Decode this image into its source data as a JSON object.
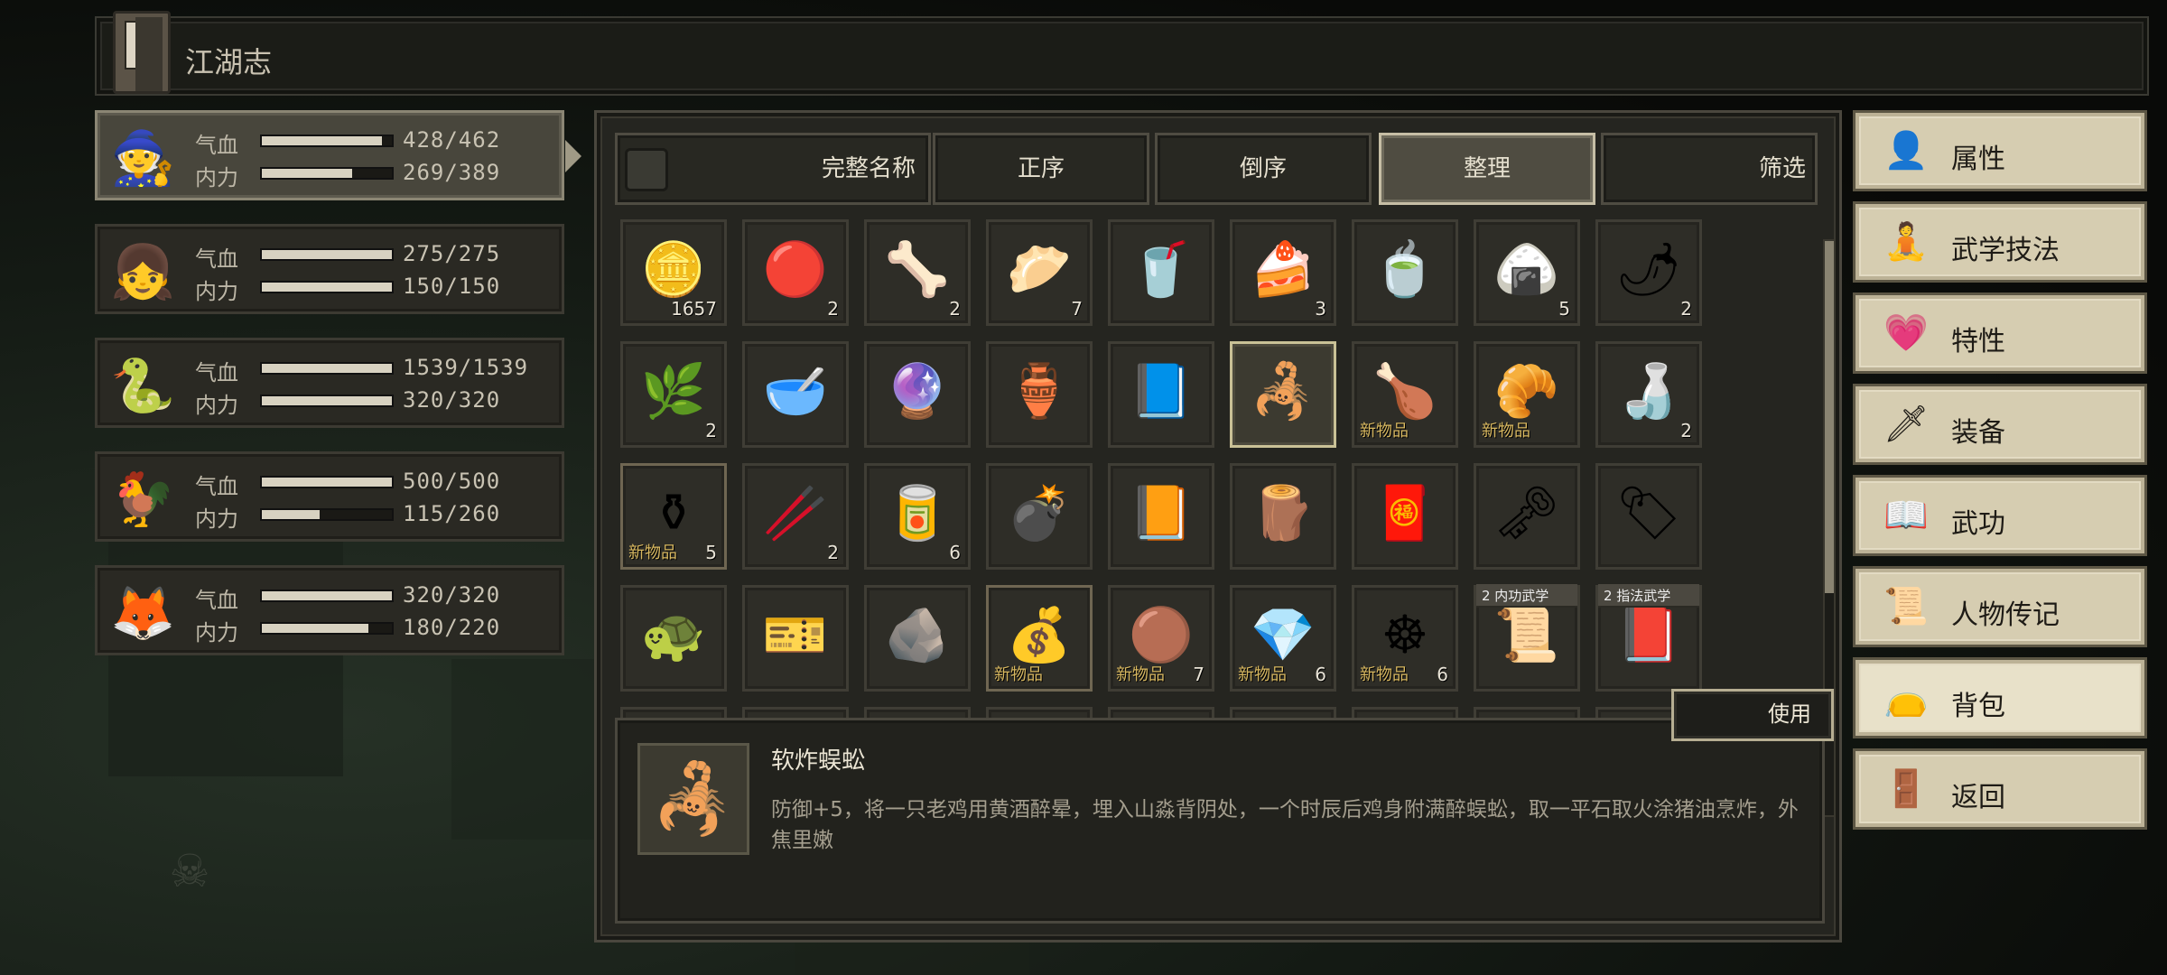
{
  "title": "江湖志",
  "party": [
    {
      "id": "hero",
      "portrait_icon": "swordsman-icon",
      "glyph": "🧙",
      "hp_label": "气血",
      "hp": "428/462",
      "hp_frac": 0.926,
      "mp_label": "内力",
      "mp": "269/389",
      "mp_frac": 0.692
    },
    {
      "id": "girl",
      "portrait_icon": "fox-girl-icon",
      "glyph": "👧",
      "hp_label": "气血",
      "hp": "275/275",
      "hp_frac": 1.0,
      "mp_label": "内力",
      "mp": "150/150",
      "mp_frac": 1.0
    },
    {
      "id": "snake",
      "portrait_icon": "snake-icon",
      "glyph": "🐍",
      "hp_label": "气血",
      "hp": "1539/1539",
      "hp_frac": 1.0,
      "mp_label": "内力",
      "mp": "320/320",
      "mp_frac": 1.0
    },
    {
      "id": "chicken",
      "portrait_icon": "chicken-icon",
      "glyph": "🐓",
      "hp_label": "气血",
      "hp": "500/500",
      "hp_frac": 1.0,
      "mp_label": "内力",
      "mp": "115/260",
      "mp_frac": 0.442
    },
    {
      "id": "fox",
      "portrait_icon": "fox-icon",
      "glyph": "🦊",
      "hp_label": "气血",
      "hp": "320/320",
      "hp_frac": 1.0,
      "mp_label": "内力",
      "mp": "180/220",
      "mp_frac": 0.818
    }
  ],
  "sort": {
    "fullname": "完整名称",
    "asc": "正序",
    "desc": "倒序",
    "arrange": "整理",
    "filter": "筛选",
    "active": "arrange"
  },
  "items": [
    {
      "icon": "copper-coins-icon",
      "glyph": "🪙",
      "count": "1657",
      "new": "",
      "tag": ""
    },
    {
      "icon": "red-coins-icon",
      "glyph": "🔴",
      "count": "2",
      "new": "",
      "tag": ""
    },
    {
      "icon": "bone-icon",
      "glyph": "🦴",
      "count": "2",
      "new": "",
      "tag": ""
    },
    {
      "icon": "steamed-bun-icon",
      "glyph": "🥟",
      "count": "7",
      "new": "",
      "tag": ""
    },
    {
      "icon": "wooden-cup-icon",
      "glyph": "🥤",
      "count": "",
      "new": "",
      "tag": ""
    },
    {
      "icon": "cake-icon",
      "glyph": "🍰",
      "count": "3",
      "new": "",
      "tag": ""
    },
    {
      "icon": "dark-cup-icon",
      "glyph": "🍵",
      "count": "",
      "new": "",
      "tag": ""
    },
    {
      "icon": "white-bun-icon",
      "glyph": "🍙",
      "count": "5",
      "new": "",
      "tag": ""
    },
    {
      "icon": "red-herb-icon",
      "glyph": "🌶",
      "count": "2",
      "new": "",
      "tag": ""
    },
    {
      "icon": "blue-herb-icon",
      "glyph": "🌿",
      "count": "2",
      "new": "",
      "tag": ""
    },
    {
      "icon": "blood-bowl-icon",
      "glyph": "🥣",
      "count": "",
      "new": "",
      "tag": ""
    },
    {
      "icon": "blue-orb-icon",
      "glyph": "🔮",
      "count": "",
      "new": "",
      "tag": ""
    },
    {
      "icon": "gourd-icon",
      "glyph": "🏺",
      "count": "",
      "new": "",
      "tag": ""
    },
    {
      "icon": "mystery-book-icon",
      "glyph": "📘",
      "count": "",
      "new": "",
      "tag": ""
    },
    {
      "icon": "fried-centipede-icon",
      "glyph": "🦂",
      "count": "",
      "new": "",
      "tag": "",
      "selected": true
    },
    {
      "icon": "roast-chicken-icon",
      "glyph": "🍗",
      "count": "",
      "new": "新物品",
      "tag": ""
    },
    {
      "icon": "fried-food-icon",
      "glyph": "🥐",
      "count": "",
      "new": "新物品",
      "tag": ""
    },
    {
      "icon": "wine-jar-icon",
      "glyph": "🍶",
      "count": "2",
      "new": "",
      "tag": ""
    },
    {
      "icon": "black-jar-icon",
      "glyph": "⚱",
      "count": "5",
      "new": "新物品",
      "tag": "",
      "highlight": true
    },
    {
      "icon": "chopsticks-icon",
      "glyph": "🥢",
      "count": "2",
      "new": "",
      "tag": ""
    },
    {
      "icon": "tin-can-icon",
      "glyph": "🥫",
      "count": "6",
      "new": "",
      "tag": ""
    },
    {
      "icon": "rooster-bomb-icon",
      "glyph": "💣",
      "count": "",
      "new": "",
      "tag": ""
    },
    {
      "icon": "star-book-icon",
      "glyph": "📙",
      "count": "",
      "new": "",
      "tag": ""
    },
    {
      "icon": "wood-bundle-icon",
      "glyph": "🪵",
      "count": "",
      "new": "",
      "tag": ""
    },
    {
      "icon": "red-cloth-icon",
      "glyph": "🧧",
      "count": "",
      "new": "",
      "tag": ""
    },
    {
      "icon": "black-key-icon",
      "glyph": "🗝",
      "count": "",
      "new": "",
      "tag": ""
    },
    {
      "icon": "red-tag-icon",
      "glyph": "🏷",
      "count": "",
      "new": "",
      "tag": ""
    },
    {
      "icon": "turtle-shell-icon",
      "glyph": "🐢",
      "count": "",
      "new": "",
      "tag": ""
    },
    {
      "icon": "jade-token-icon",
      "glyph": "🎫",
      "count": "",
      "new": "",
      "tag": ""
    },
    {
      "icon": "iron-ore-icon",
      "glyph": "🪨",
      "count": "",
      "new": "",
      "tag": ""
    },
    {
      "icon": "cloth-sack-icon",
      "glyph": "💰",
      "count": "",
      "new": "新物品",
      "tag": "",
      "highlight": true
    },
    {
      "icon": "brown-stone-icon",
      "glyph": "🟤",
      "count": "7",
      "new": "新物品",
      "tag": ""
    },
    {
      "icon": "teal-stone-icon",
      "glyph": "💎",
      "count": "6",
      "new": "新物品",
      "tag": ""
    },
    {
      "icon": "wooden-wheel-icon",
      "glyph": "☸",
      "count": "6",
      "new": "新物品",
      "tag": ""
    },
    {
      "icon": "crossed-scroll-icon",
      "glyph": "📜",
      "count": "",
      "new": "",
      "tag": "2 内功武学"
    },
    {
      "icon": "finger-manual-icon",
      "glyph": "📕",
      "count": "",
      "new": "",
      "tag": "2 指法武学"
    }
  ],
  "use_button": "使用",
  "detail": {
    "icon": "fried-centipede-icon",
    "glyph": "🦂",
    "name": "软炸蜈蚣",
    "text": "防御+5，将一只老鸡用黄酒醉晕，埋入山淼背阴处，一个时辰后鸡身附满醉蜈蚣，取一平石取火涂猪油烹炸，外焦里嫩"
  },
  "menu": [
    {
      "id": "attributes",
      "icon": "person-icon",
      "glyph": "👤",
      "label": "属性"
    },
    {
      "id": "martial-skills",
      "icon": "spark-person-icon",
      "glyph": "🧘",
      "label": "武学技法"
    },
    {
      "id": "traits",
      "icon": "heart-person-icon",
      "glyph": "💗",
      "label": "特性"
    },
    {
      "id": "equipment",
      "icon": "sword-icon",
      "glyph": "🗡",
      "label": "装备"
    },
    {
      "id": "kungfu",
      "icon": "manual-icon",
      "glyph": "📖",
      "label": "武功"
    },
    {
      "id": "biography",
      "icon": "scroll-icon",
      "glyph": "📜",
      "label": "人物传记"
    },
    {
      "id": "bag",
      "icon": "bag-icon",
      "glyph": "👝",
      "label": "背包",
      "active": true
    },
    {
      "id": "back",
      "icon": "door-icon",
      "glyph": "🚪",
      "label": "返回"
    }
  ]
}
